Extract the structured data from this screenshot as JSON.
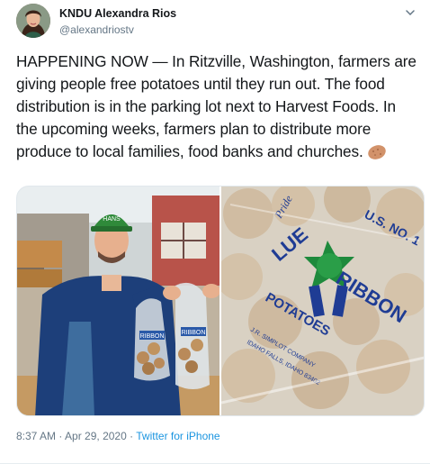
{
  "author": {
    "display_name": "KNDU Alexandra Rios",
    "handle": "@alexandriostv",
    "avatar_icon": "profile-photo"
  },
  "tweet": {
    "text": "HAPPENING NOW — In Ritzville, Washington, farmers are giving people free potatoes until they run out. The food distribution is in the parking lot next to Harvest Foods. In the upcoming weeks, farmers plan to distribute more produce to local families, food banks and churches.",
    "emoji_icon": "potato-emoji"
  },
  "media": {
    "photo_left_icon": "farmer-holding-potato-bags-photo",
    "photo_right_icon": "blue-ribbon-potato-sack-photo",
    "cap_text": "HANS",
    "bag_brand": "RIBBON",
    "sack_lines": [
      "U.S. NO. 1",
      "Pride",
      "LUE",
      "RIBBON",
      "POTATOES",
      "J.R. SIMPLOT COMPANY",
      "IDAHO FALLS, IDAHO 83402"
    ]
  },
  "footer": {
    "time": "8:37 AM",
    "separator": "·",
    "date": "Apr 29, 2020",
    "source": "Twitter for iPhone"
  },
  "colors": {
    "link": "#1b95e0",
    "muted": "#657786",
    "text": "#14171a"
  }
}
